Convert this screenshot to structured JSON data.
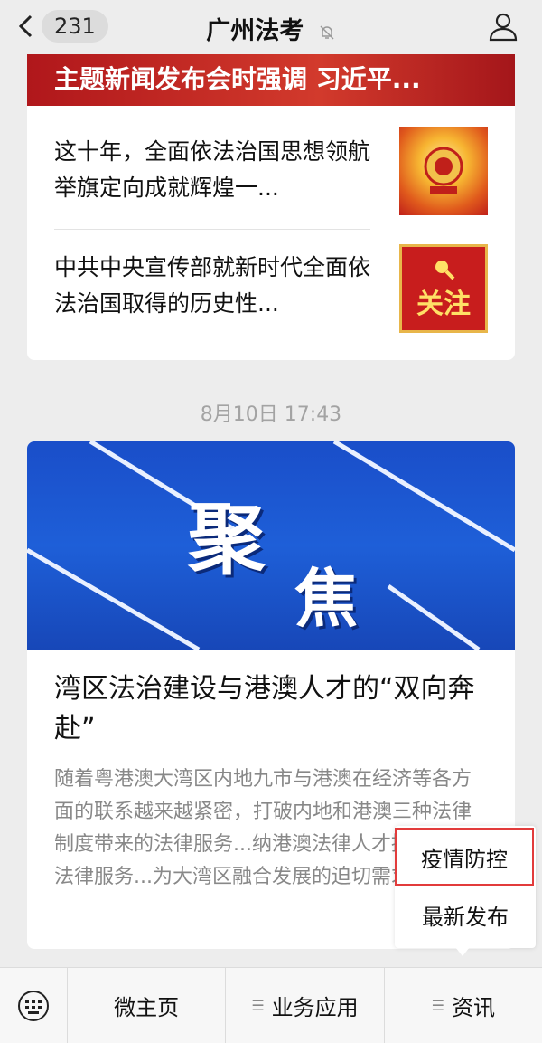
{
  "header": {
    "unread_count": "231",
    "title": "广州法考"
  },
  "card1": {
    "hero_title": "主题新闻发布会时强调 习近平...",
    "articles": [
      {
        "title": "这十年，全面依法治国思想领航举旗定向成就辉煌一..."
      },
      {
        "title": "中共中央宣传部就新时代全面依法治国取得的历史性...",
        "thumb_text": "关注"
      }
    ]
  },
  "timestamp": "8月10日 17:43",
  "card2": {
    "cover_text_1": "聚",
    "cover_text_2": "焦",
    "title": "湾区法治建设与港澳人才的“双向奔赴”",
    "description": "随着粤港澳大湾区内地九市与港澳在经济等各方面的联系越来越紧密，打破内地和港澳三种法律制度带来的法律服务...纳港澳法律人才提供跨境法律服务...为大湾区融合发展的迫切需求。"
  },
  "popup_menu": {
    "items": [
      "疫情防控",
      "最新发布"
    ]
  },
  "bottom_menu": {
    "tabs": [
      "微主页",
      "业务应用",
      "资讯"
    ]
  },
  "colors": {
    "background": "#ededed",
    "highlight_border": "#e23b3b",
    "cover_blue": "#1e5fd8"
  }
}
